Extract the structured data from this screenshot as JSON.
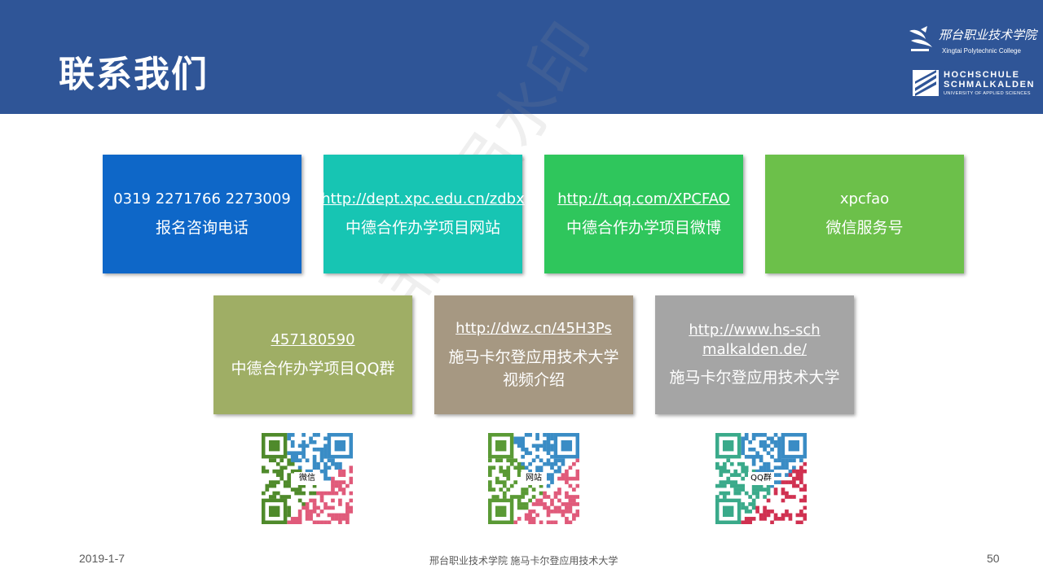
{
  "slide": {
    "title": "联系我们"
  },
  "logos": {
    "xpc_cn": "邢台职业技术学院",
    "xpc_en": "Xingtai Polytechnic College",
    "hs_line1": "HOCHSCHULE",
    "hs_line2": "SCHMALKALDEN",
    "hs_line3": "UNIVERSITY OF APPLIED SCIENCES"
  },
  "watermark": "非会员水印",
  "contacts": [
    {
      "value": "0319 2271766 2273009",
      "desc": "报名咨询电话",
      "color": "#0e67c8"
    },
    {
      "value": "http://dept.xpc.edu.cn/zdbx",
      "desc": "中德合作办学项目网站",
      "color": "#17c5b3"
    },
    {
      "value": "http://t.qq.com/XPCFAO",
      "desc": "中德合作办学项目微博",
      "color": "#2fc65c"
    },
    {
      "value": "xpcfao",
      "desc": "微信服务号",
      "color": "#6cc04a"
    },
    {
      "value": "457180590",
      "desc": "中德合作办学项目QQ群",
      "color": "#9fae65"
    },
    {
      "value": "http://dwz.cn/45H3Ps",
      "desc": "施马卡尔登应用技术大学视频介绍",
      "color": "#a69882"
    },
    {
      "value": "http://www.hs-schmalkalden.de/",
      "desc": "施马卡尔登应用技术大学",
      "color": "#a5a5a5"
    }
  ],
  "qr_codes": [
    {
      "label": "微信"
    },
    {
      "label": "网站"
    },
    {
      "label": "QQ群"
    }
  ],
  "footer": {
    "date": "2019-1-7",
    "center": "邢台职业技术学院 施马卡尔登应用技术大学",
    "page": "50"
  }
}
